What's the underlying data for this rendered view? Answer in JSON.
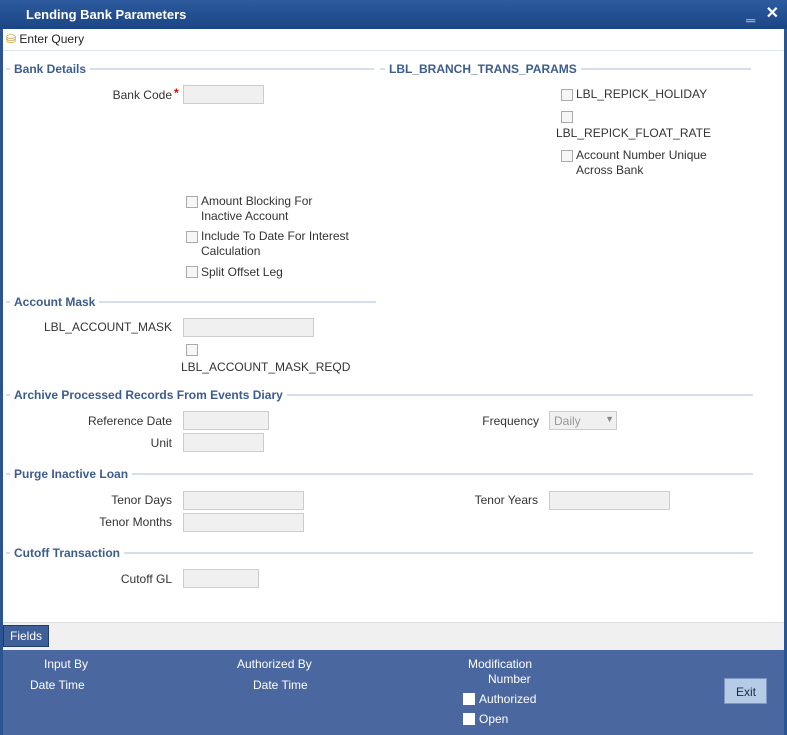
{
  "window": {
    "title": "Lending Bank Parameters",
    "minimize": "‗",
    "close": "✕"
  },
  "toolbar": {
    "enter_query": "Enter Query"
  },
  "bank_details": {
    "title": "Bank Details",
    "bank_code_label": "Bank Code",
    "required": "*",
    "bank_code_value": "",
    "amount_blocking": "Amount Blocking For Inactive Account",
    "include_to_date": "Include To Date For Interest Calculation",
    "split_offset": "Split Offset Leg"
  },
  "branch_trans": {
    "title": "LBL_BRANCH_TRANS_PARAMS",
    "repick_holiday": "LBL_REPICK_HOLIDAY",
    "repick_float_rate": "LBL_REPICK_FLOAT_RATE",
    "account_unique": "Account Number Unique Across Bank"
  },
  "account_mask": {
    "title": "Account Mask",
    "mask_label": "LBL_ACCOUNT_MASK",
    "mask_value": "",
    "mask_reqd": "LBL_ACCOUNT_MASK_REQD"
  },
  "archive": {
    "title": "Archive Processed Records From Events Diary",
    "reference_date": "Reference Date",
    "unit": "Unit",
    "frequency": "Frequency",
    "frequency_value": "Daily"
  },
  "purge": {
    "title": "Purge Inactive Loan",
    "tenor_days": "Tenor Days",
    "tenor_months": "Tenor Months",
    "tenor_years": "Tenor Years"
  },
  "cutoff": {
    "title": "Cutoff Transaction",
    "cutoff_gl": "Cutoff GL"
  },
  "tabs": {
    "fields": "Fields"
  },
  "footer": {
    "input_by": "Input By",
    "date_time1": "Date Time",
    "authorized_by": "Authorized By",
    "date_time2": "Date Time",
    "modification": "Modification",
    "number": "Number",
    "authorized": "Authorized",
    "open": "Open",
    "exit": "Exit"
  }
}
